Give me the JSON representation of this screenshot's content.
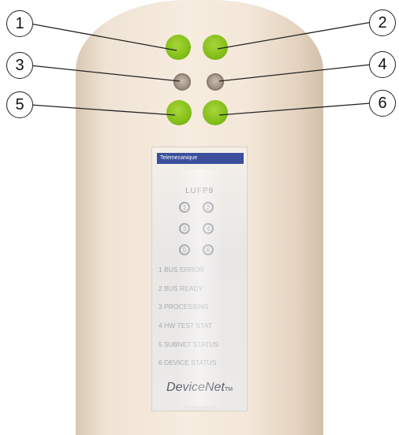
{
  "callouts": [
    "1",
    "2",
    "3",
    "4",
    "5",
    "6"
  ],
  "panel": {
    "brand": "Telemecanique",
    "title": "LUFP9",
    "indicator_numbers": [
      "1",
      "2",
      "3",
      "4",
      "5",
      "6"
    ],
    "legend": [
      "1 BUS ERROR",
      "2 BUS READY",
      "3 PROCESSING",
      "4 HW TEST STAT",
      "5 SUBNET STATUS",
      "6 DEVICE STATUS"
    ],
    "logo": "DeviceNet",
    "logo_tm": "TM"
  },
  "colors": {
    "led_green": "#86c11a",
    "brand_strip": "#3b4f9d",
    "body": "#f3e7d9"
  },
  "leds": [
    "green",
    "green",
    "off",
    "off",
    "green",
    "green"
  ]
}
